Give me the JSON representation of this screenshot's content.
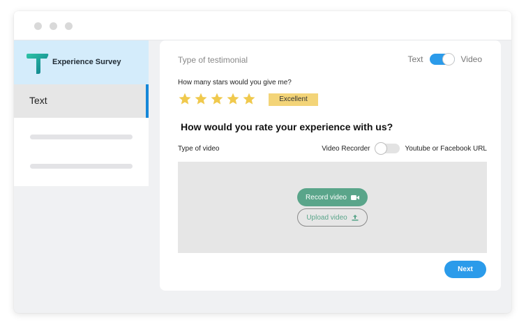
{
  "sidebar": {
    "brand_name": "Experience Survey",
    "active_item": "Text"
  },
  "card": {
    "type_label": "Type of testimonial",
    "toggle_left": "Text",
    "toggle_right": "Video",
    "stars_question": "How many stars would you give me?",
    "stars_rating": 5,
    "stars_max": 5,
    "rating_badge": "Excellent",
    "question": "How would you rate your experience with us?",
    "video_type_label": "Type of video",
    "recorder_left": "Video Recorder",
    "recorder_right": "Youtube or Facebook URL",
    "record_button": "Record video",
    "upload_button": "Upload video",
    "next_button": "Next"
  },
  "colors": {
    "accent": "#2b9bea",
    "green": "#5aa58a",
    "star": "#f0c94d",
    "brand_bg": "#d4ecfb"
  },
  "icons": {
    "logo": "t-logo-icon",
    "star": "star-icon",
    "camera": "video-camera-icon",
    "upload": "upload-icon"
  }
}
